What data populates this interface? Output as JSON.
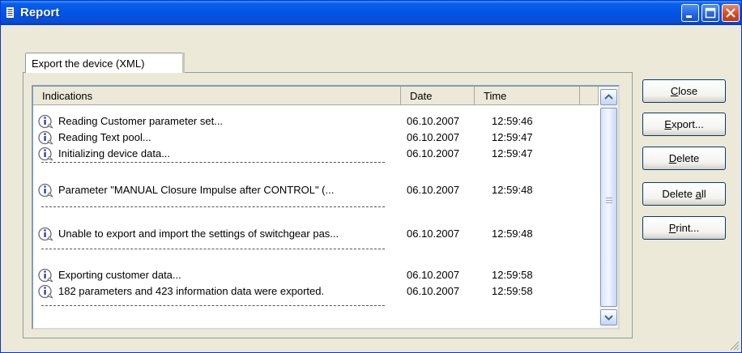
{
  "window": {
    "title": "Report"
  },
  "tab": {
    "label": "Export the device (XML)"
  },
  "columns": [
    "Indications",
    "Date",
    "Time"
  ],
  "rows": [
    {
      "kind": "entry",
      "text": "Reading Customer parameter set...",
      "date": "06.10.2007",
      "time": "12:59:46"
    },
    {
      "kind": "entry",
      "text": "Reading Text pool...",
      "date": "06.10.2007",
      "time": "12:59:47"
    },
    {
      "kind": "entry",
      "text": "Initializing device data...",
      "date": "06.10.2007",
      "time": "12:59:47"
    },
    {
      "kind": "separator"
    },
    {
      "kind": "entry",
      "text": "Parameter \"MANUAL Closure Impulse after CONTROL\" (...",
      "date": "06.10.2007",
      "time": "12:59:48"
    },
    {
      "kind": "separator"
    },
    {
      "kind": "entry",
      "text": "Unable to export and import the settings of switchgear pas...",
      "date": "06.10.2007",
      "time": "12:59:48"
    },
    {
      "kind": "separator"
    },
    {
      "kind": "entry",
      "text": "Exporting customer data...",
      "date": "06.10.2007",
      "time": "12:59:58"
    },
    {
      "kind": "entry",
      "text": "182 parameters and 423 information data were exported.",
      "date": "06.10.2007",
      "time": "12:59:58"
    },
    {
      "kind": "separator"
    }
  ],
  "buttons": {
    "close": {
      "pre": "",
      "u": "C",
      "post": "lose"
    },
    "export": {
      "pre": "",
      "u": "E",
      "post": "xport..."
    },
    "delete": {
      "pre": "",
      "u": "D",
      "post": "elete"
    },
    "delete_all": {
      "pre": "Delete ",
      "u": "a",
      "post": "ll"
    },
    "print": {
      "pre": "",
      "u": "P",
      "post": "rint..."
    }
  },
  "icons": {
    "row_icon": "info-icon",
    "title_icon": "report-icon"
  }
}
